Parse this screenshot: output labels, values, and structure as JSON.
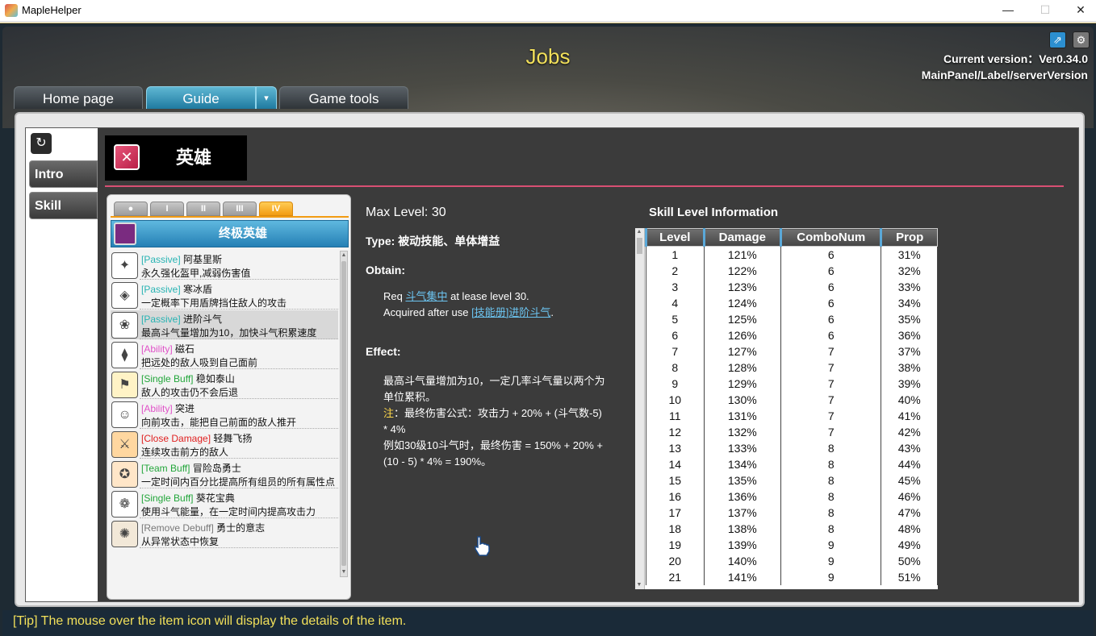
{
  "window": {
    "title": "MapleHelper",
    "min": "—",
    "max": "☐",
    "close": "✕"
  },
  "header": {
    "title": "Jobs",
    "version_line1": "Current version：Ver0.34.0",
    "version_line2": "MainPanel/Label/serverVersion",
    "icons": [
      "external-link-icon",
      "gear-icon"
    ]
  },
  "tabs": [
    {
      "label": "Home page"
    },
    {
      "label": "Guide"
    },
    {
      "label": "Game tools"
    }
  ],
  "nav": {
    "items": [
      "Intro",
      "Skill"
    ]
  },
  "job": {
    "name": "英雄"
  },
  "tiers": [
    "●",
    "I",
    "II",
    "III",
    "IV"
  ],
  "class_title": "终极英雄",
  "skills": [
    {
      "tag": "[Passive]",
      "tag_color": "#27b3b3",
      "name": "阿基里斯",
      "desc": "永久强化盔甲,减弱伤害值"
    },
    {
      "tag": "[Passive]",
      "tag_color": "#27b3b3",
      "name": "寒冰盾",
      "desc": "一定概率下用盾牌挡住敌人的攻击"
    },
    {
      "tag": "[Passive]",
      "tag_color": "#27b3b3",
      "name": "进阶斗气",
      "desc": "最高斗气量增加为10，加快斗气积累速度"
    },
    {
      "tag": "[Ability]",
      "tag_color": "#e052c8",
      "name": "磁石",
      "desc": "把远处的敌人吸到自己面前"
    },
    {
      "tag": "[Single Buff]",
      "tag_color": "#22a63a",
      "name": "稳如泰山",
      "desc": "敌人的攻击仍不会后退"
    },
    {
      "tag": "[Ability]",
      "tag_color": "#e052c8",
      "name": "突进",
      "desc": "向前攻击，能把自己前面的敌人推开"
    },
    {
      "tag": "[Close Damage]",
      "tag_color": "#e02020",
      "name": "轻舞飞扬",
      "desc": "连续攻击前方的敌人"
    },
    {
      "tag": "[Team Buff]",
      "tag_color": "#22a63a",
      "name": "冒险岛勇士",
      "desc": "一定时间内百分比提高所有组员的所有属性点"
    },
    {
      "tag": "[Single Buff]",
      "tag_color": "#22a63a",
      "name": "葵花宝典",
      "desc": "使用斗气能量，在一定时间内提高攻击力"
    },
    {
      "tag": "[Remove Debuff]",
      "tag_color": "#777777",
      "name": "勇士的意志",
      "desc": "从异常状态中恢复"
    }
  ],
  "detail": {
    "max_level": "Max Level: 30",
    "type_label": "Type: ",
    "type_value": "被动技能、单体增益",
    "obtain_label": "Obtain:",
    "req_prefix": "Req ",
    "req_link": "斗气集中",
    "req_suffix": " at lease level 30.",
    "acq_prefix": "Acquired after use ",
    "acq_link": "[技能册]进阶斗气",
    "acq_suffix": ".",
    "effect_label": "Effect:",
    "effect_line1": "最高斗气量增加为10，一定几率斗气量以两个为",
    "effect_line2": "单位累积。",
    "note_label": "注",
    "note_line1": "：最终伤害公式：攻击力 + 20% + (斗气数-5)",
    "note_line2": "* 4%",
    "example_line1": "例如30级10斗气时，最终伤害 = 150% + 20% +",
    "example_line2": "(10 - 5) * 4% = 190%。"
  },
  "table": {
    "title": "Skill Level Information",
    "headers": [
      "Level",
      "Damage",
      "ComboNum",
      "Prop"
    ],
    "rows": [
      [
        "1",
        "121%",
        "6",
        "31%"
      ],
      [
        "2",
        "122%",
        "6",
        "32%"
      ],
      [
        "3",
        "123%",
        "6",
        "33%"
      ],
      [
        "4",
        "124%",
        "6",
        "34%"
      ],
      [
        "5",
        "125%",
        "6",
        "35%"
      ],
      [
        "6",
        "126%",
        "6",
        "36%"
      ],
      [
        "7",
        "127%",
        "7",
        "37%"
      ],
      [
        "8",
        "128%",
        "7",
        "38%"
      ],
      [
        "9",
        "129%",
        "7",
        "39%"
      ],
      [
        "10",
        "130%",
        "7",
        "40%"
      ],
      [
        "11",
        "131%",
        "7",
        "41%"
      ],
      [
        "12",
        "132%",
        "7",
        "42%"
      ],
      [
        "13",
        "133%",
        "8",
        "43%"
      ],
      [
        "14",
        "134%",
        "8",
        "44%"
      ],
      [
        "15",
        "135%",
        "8",
        "45%"
      ],
      [
        "16",
        "136%",
        "8",
        "46%"
      ],
      [
        "17",
        "137%",
        "8",
        "47%"
      ],
      [
        "18",
        "138%",
        "8",
        "48%"
      ],
      [
        "19",
        "139%",
        "9",
        "49%"
      ],
      [
        "20",
        "140%",
        "9",
        "50%"
      ],
      [
        "21",
        "141%",
        "9",
        "51%"
      ]
    ]
  },
  "tip": "[Tip] The mouse over the item icon will display the details of the item."
}
